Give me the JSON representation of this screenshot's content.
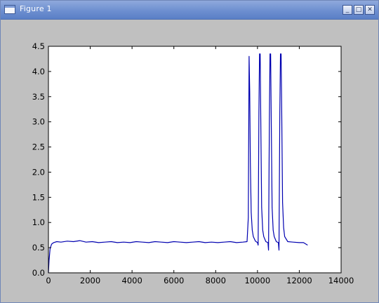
{
  "window": {
    "title": "Figure 1",
    "buttons": {
      "minimize": "_",
      "maximize": "□",
      "close": "✕"
    },
    "icon": "window-icon"
  },
  "chart_data": {
    "type": "line",
    "title": "",
    "xlabel": "",
    "ylabel": "",
    "xlim": [
      0,
      14000
    ],
    "ylim": [
      0.0,
      4.5
    ],
    "x_ticks": [
      0,
      2000,
      4000,
      6000,
      8000,
      10000,
      12000,
      14000
    ],
    "x_tick_labels": [
      "0",
      "2000",
      "4000",
      "6000",
      "8000",
      "10000",
      "12000",
      "14000"
    ],
    "y_ticks": [
      0.0,
      0.5,
      1.0,
      1.5,
      2.0,
      2.5,
      3.0,
      3.5,
      4.0,
      4.5
    ],
    "y_tick_labels": [
      "0.0",
      "0.5",
      "1.0",
      "1.5",
      "2.0",
      "2.5",
      "3.0",
      "3.5",
      "4.0",
      "4.5"
    ],
    "grid": false,
    "line_color": "#0000b0",
    "series": [
      {
        "x": [
          0,
          30,
          80,
          150,
          250,
          400,
          600,
          900,
          1200,
          1500,
          1800,
          2100,
          2400,
          2700,
          3000,
          3300,
          3600,
          3900,
          4200,
          4500,
          4800,
          5100,
          5400,
          5700,
          6000,
          6300,
          6600,
          6900,
          7200,
          7500,
          7800,
          8100,
          8400,
          8700,
          9000,
          9300,
          9500,
          9560,
          9600,
          9630,
          9660,
          9700,
          9750,
          9800,
          9900,
          10000,
          10030,
          10070,
          10100,
          10130,
          10160,
          10200,
          10250,
          10300,
          10400,
          10500,
          10530,
          10570,
          10600,
          10630,
          10660,
          10700,
          10750,
          10800,
          10900,
          11000,
          11030,
          11070,
          11100,
          11130,
          11160,
          11200,
          11250,
          11300,
          11450,
          11700,
          12000,
          12200,
          12400
        ],
        "y": [
          0.0,
          0.25,
          0.48,
          0.57,
          0.6,
          0.62,
          0.61,
          0.63,
          0.62,
          0.64,
          0.61,
          0.62,
          0.6,
          0.61,
          0.62,
          0.6,
          0.61,
          0.6,
          0.62,
          0.61,
          0.6,
          0.62,
          0.61,
          0.6,
          0.62,
          0.61,
          0.6,
          0.61,
          0.62,
          0.6,
          0.61,
          0.6,
          0.61,
          0.62,
          0.6,
          0.61,
          0.62,
          1.1,
          4.3,
          3.6,
          2.2,
          1.2,
          0.85,
          0.72,
          0.63,
          0.6,
          0.55,
          3.2,
          4.35,
          4.35,
          3.0,
          1.3,
          0.85,
          0.72,
          0.62,
          0.6,
          0.45,
          3.0,
          4.35,
          4.35,
          3.0,
          1.3,
          0.85,
          0.72,
          0.62,
          0.6,
          0.45,
          3.2,
          4.35,
          4.35,
          3.2,
          1.4,
          0.9,
          0.72,
          0.62,
          0.61,
          0.6,
          0.6,
          0.55
        ]
      }
    ]
  }
}
